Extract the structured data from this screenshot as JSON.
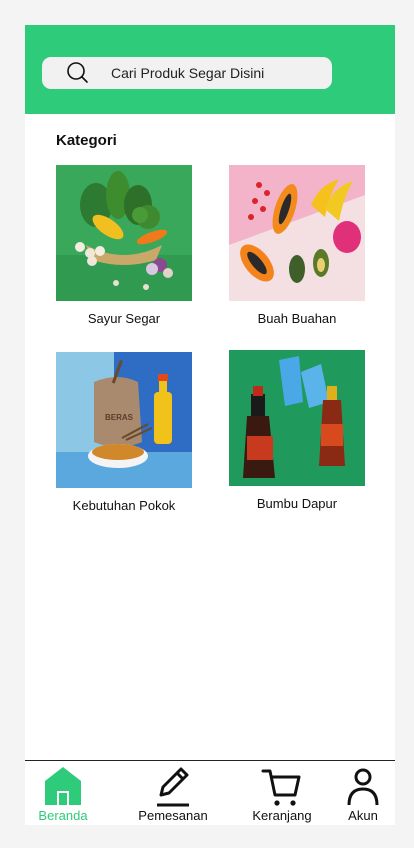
{
  "colors": {
    "accent": "#2ecc7a",
    "text": "#111111"
  },
  "search": {
    "placeholder": "Cari Produk Segar Disini",
    "icon": "search-icon"
  },
  "section": {
    "title": "Kategori"
  },
  "categories": [
    {
      "label": "Sayur Segar",
      "image": "vegetables-photo"
    },
    {
      "label": "Buah Buahan",
      "image": "fruits-photo"
    },
    {
      "label": "Kebutuhan Pokok",
      "image": "staples-photo",
      "sack_text": "BERAS"
    },
    {
      "label": "Bumbu Dapur",
      "image": "seasoning-photo"
    }
  ],
  "nav": [
    {
      "label": "Beranda",
      "icon": "home-icon",
      "active": true
    },
    {
      "label": "Pemesanan",
      "icon": "pencil-icon",
      "active": false
    },
    {
      "label": "Keranjang",
      "icon": "cart-icon",
      "active": false
    },
    {
      "label": "Akun",
      "icon": "user-icon",
      "active": false
    }
  ]
}
